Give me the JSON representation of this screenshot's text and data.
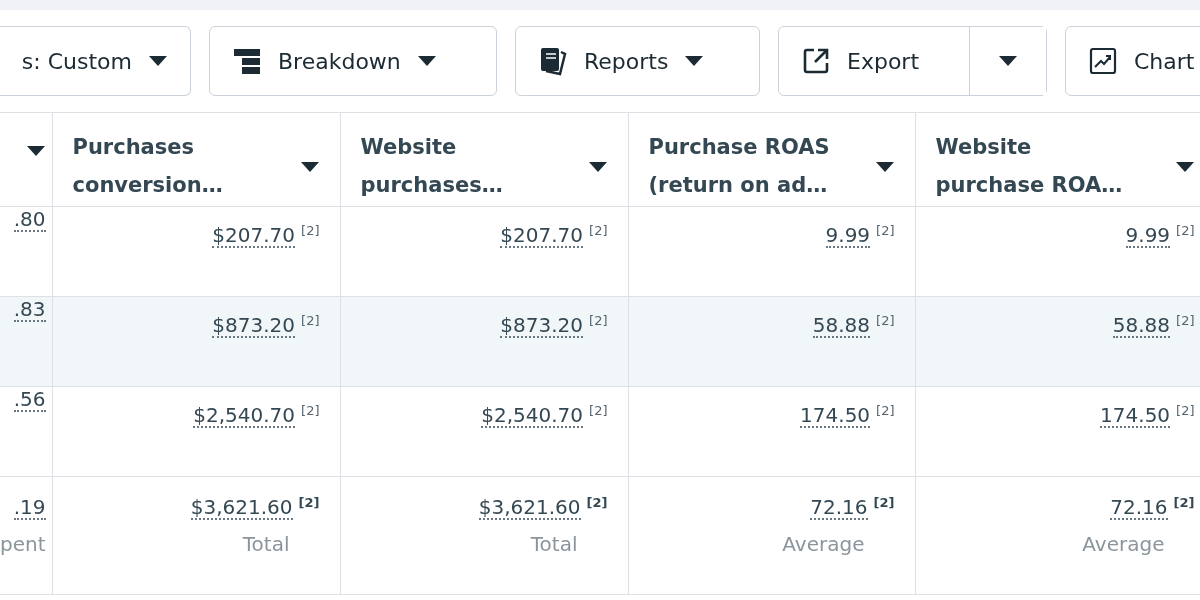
{
  "toolbar": [
    {
      "label": "s: Custom",
      "kind": "dropdown"
    },
    {
      "label": "Breakdown",
      "kind": "dropdown"
    },
    {
      "label": "Reports",
      "kind": "dropdown"
    },
    {
      "label": "Export",
      "kind": "split"
    },
    {
      "label": "Chart",
      "kind": "button"
    }
  ],
  "table": {
    "columns": [
      {},
      {
        "lines": [
          "Purchases",
          "conversion…"
        ]
      },
      {
        "lines": [
          "Website",
          "purchases…"
        ]
      },
      {
        "lines": [
          "Purchase ROAS",
          "(return on ad…"
        ]
      },
      {
        "lines": [
          "Website",
          "purchase ROA…"
        ]
      }
    ],
    "rows": [
      {
        "highlighted": false,
        "cells": [
          {
            "value": ".80"
          },
          {
            "value": "$207.70",
            "note": "[2]"
          },
          {
            "value": "$207.70",
            "note": "[2]"
          },
          {
            "value": "9.99",
            "note": "[2]"
          },
          {
            "value": "9.99",
            "note": "[2]"
          }
        ]
      },
      {
        "highlighted": true,
        "cells": [
          {
            "value": ".83"
          },
          {
            "value": "$873.20",
            "note": "[2]"
          },
          {
            "value": "$873.20",
            "note": "[2]"
          },
          {
            "value": "58.88",
            "note": "[2]"
          },
          {
            "value": "58.88",
            "note": "[2]"
          }
        ]
      },
      {
        "highlighted": false,
        "cells": [
          {
            "value": ".56"
          },
          {
            "value": "$2,540.70",
            "note": "[2]"
          },
          {
            "value": "$2,540.70",
            "note": "[2]"
          },
          {
            "value": "174.50",
            "note": "[2]"
          },
          {
            "value": "174.50",
            "note": "[2]"
          }
        ]
      }
    ],
    "totals": [
      {
        "value": ".19",
        "caption": "pent"
      },
      {
        "value": "$3,621.60",
        "note": "[2]",
        "caption": "Total"
      },
      {
        "value": "$3,621.60",
        "note": "[2]",
        "caption": "Total"
      },
      {
        "value": "72.16",
        "note": "[2]",
        "caption": "Average"
      },
      {
        "value": "72.16",
        "note": "[2]",
        "caption": "Average"
      }
    ]
  }
}
